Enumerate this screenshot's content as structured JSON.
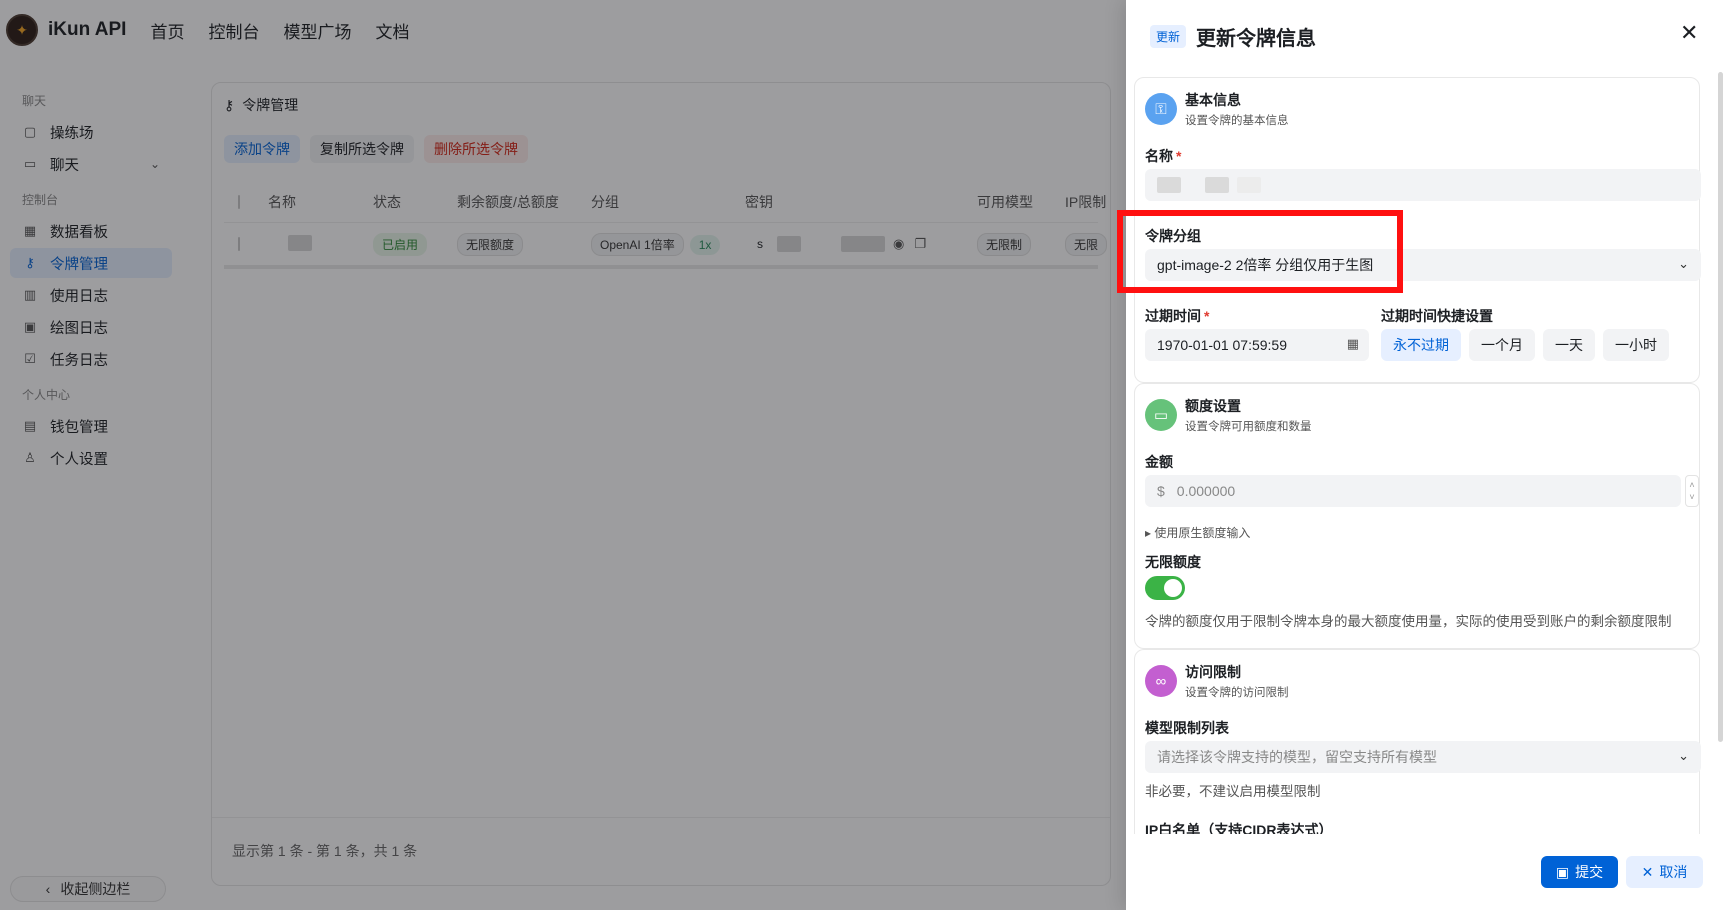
{
  "app": {
    "brand": "iKun API",
    "nav": [
      "首页",
      "控制台",
      "模型广场",
      "文档"
    ]
  },
  "sidebar": {
    "sections": [
      {
        "title": "聊天",
        "items": [
          {
            "label": "操练场",
            "icon": "playground-icon"
          },
          {
            "label": "聊天",
            "icon": "chat-icon",
            "chevron": true
          }
        ]
      },
      {
        "title": "控制台",
        "items": [
          {
            "label": "数据看板",
            "icon": "dashboard-icon"
          },
          {
            "label": "令牌管理",
            "icon": "key-icon",
            "active": true
          },
          {
            "label": "使用日志",
            "icon": "bar-chart-icon"
          },
          {
            "label": "绘图日志",
            "icon": "image-icon"
          },
          {
            "label": "任务日志",
            "icon": "checklist-icon"
          }
        ]
      },
      {
        "title": "个人中心",
        "items": [
          {
            "label": "钱包管理",
            "icon": "wallet-icon"
          },
          {
            "label": "个人设置",
            "icon": "user-icon"
          }
        ]
      }
    ],
    "collapse_label": "收起侧边栏"
  },
  "tokens_page": {
    "title": "令牌管理",
    "actions": {
      "add": "添加令牌",
      "copy": "复制所选令牌",
      "delete": "删除所选令牌"
    },
    "columns": [
      "名称",
      "状态",
      "剩余额度/总额度",
      "分组",
      "密钥",
      "可用模型",
      "IP限制"
    ],
    "row": {
      "status": "已启用",
      "quota": "无限额度",
      "group": "OpenAI 1倍率",
      "multiplier": "1x",
      "key_prefix": "s",
      "models": "无限制",
      "ip": "无限"
    },
    "pager": "显示第 1 条 - 第 1 条，共 1 条"
  },
  "drawer": {
    "tag": "更新",
    "title": "更新令牌信息",
    "basic": {
      "title": "基本信息",
      "subtitle": "设置令牌的基本信息",
      "name_label": "名称",
      "required_mark": "*",
      "group_label": "令牌分组",
      "group_value": "gpt-image-2 2倍率 分组仅用于生图",
      "expire_label": "过期时间",
      "expire_value": "1970-01-01 07:59:59",
      "quick_label": "过期时间快捷设置",
      "quick_options": [
        "永不过期",
        "一个月",
        "一天",
        "一小时"
      ]
    },
    "quota": {
      "title": "额度设置",
      "subtitle": "设置令牌可用额度和数量",
      "amount_label": "金额",
      "currency": "$",
      "amount_placeholder": "0.000000",
      "raw_input_link": "▸ 使用原生额度输入",
      "unlimited_label": "无限额度",
      "unlimited_on": true,
      "hint": "令牌的额度仅用于限制令牌本身的最大额度使用量，实际的使用受到账户的剩余额度限制"
    },
    "access": {
      "title": "访问限制",
      "subtitle": "设置令牌的访问限制",
      "models_label": "模型限制列表",
      "models_placeholder": "请选择该令牌支持的模型，留空支持所有模型",
      "models_hint": "非必要，不建议启用模型限制",
      "ip_label": "IP白名单（支持CIDR表达式）"
    },
    "submit": "提交",
    "cancel": "取消"
  },
  "colors": {
    "primary": "#0062d6",
    "danger": "#d52515",
    "toggle_on": "#3bb346",
    "highlight": "#ff1010"
  }
}
